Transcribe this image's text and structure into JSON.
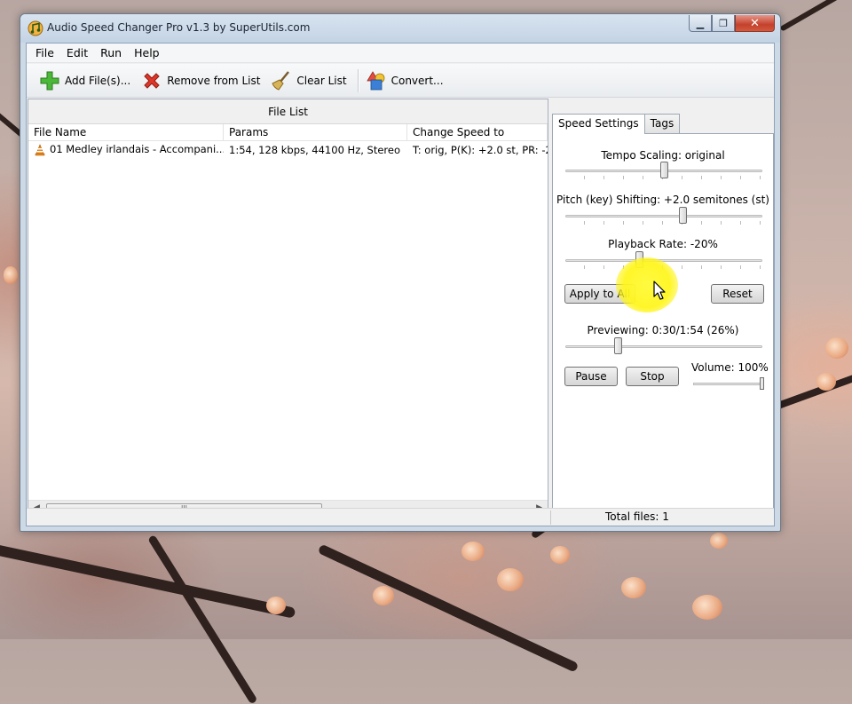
{
  "window": {
    "title": "Audio Speed Changer Pro v1.3 by SuperUtils.com",
    "controls": {
      "minimize": "▁",
      "maximize": "❐",
      "close": "✕"
    }
  },
  "menu": [
    "File",
    "Edit",
    "Run",
    "Help"
  ],
  "toolbar": {
    "add_label": "Add File(s)...",
    "remove_label": "Remove from List",
    "clear_label": "Clear List",
    "convert_label": "Convert..."
  },
  "file_list": {
    "title": "File List",
    "columns": [
      "File Name",
      "Params",
      "Change Speed to"
    ],
    "rows": [
      {
        "name": "01 Medley irlandais - Accompani...",
        "params": "1:54, 128 kbps, 44100 Hz, Stereo",
        "speed": "T: orig, P(K): +2.0 st, PR: -2"
      }
    ],
    "scroll_thumb_glyph": "III"
  },
  "tabs": [
    "Speed Settings",
    "Tags"
  ],
  "speed_settings": {
    "tempo_label": "Tempo Scaling: original",
    "tempo_level": 0.5,
    "pitch_label": "Pitch (key) Shifting: +2.0 semitones (st)",
    "pitch_level": 0.6,
    "playback_label": "Playback Rate: -20%",
    "playback_level": 0.37,
    "apply_label": "Apply to All",
    "reset_label": "Reset",
    "preview_label": "Previewing: 0:30/1:54 (26%)",
    "preview_level": 0.26,
    "pause_label": "Pause",
    "stop_label": "Stop",
    "volume_label": "Volume: 100%",
    "volume_level": 1.0
  },
  "status": {
    "total_files": "Total files: 1"
  },
  "colors": {
    "highlight": "#fff63c",
    "close_button": "#c4412c"
  }
}
